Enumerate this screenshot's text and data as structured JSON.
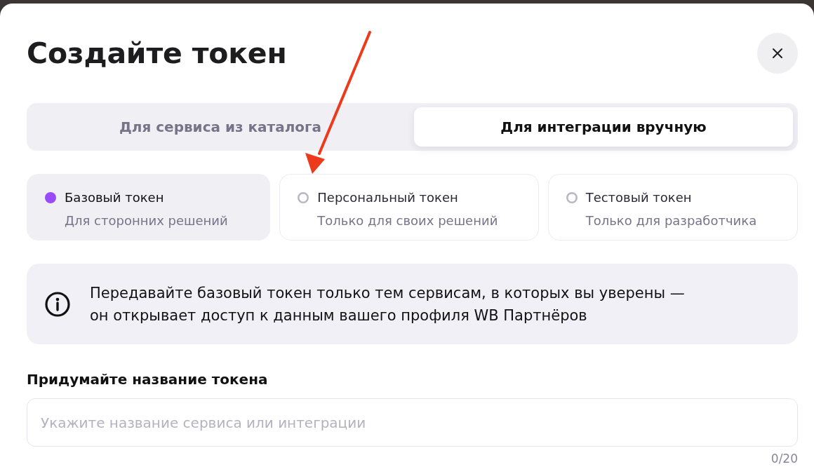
{
  "dialog": {
    "title": "Создайте токен"
  },
  "tabs": [
    {
      "label": "Для сервиса из каталога",
      "selected": false
    },
    {
      "label": "Для интеграции вручную",
      "selected": true
    }
  ],
  "token_types": [
    {
      "title": "Базовый токен",
      "subtitle": "Для сторонних решений",
      "selected": true
    },
    {
      "title": "Персональный токен",
      "subtitle": "Только для своих решений",
      "selected": false
    },
    {
      "title": "Тестовый токен",
      "subtitle": "Только для разработчика",
      "selected": false
    }
  ],
  "notice": {
    "text": "Передавайте базовый токен только тем сервисам, в которых вы уверены — он открывает доступ к данным вашего профиля WB Партнёров"
  },
  "name_field": {
    "label": "Придумайте название токена",
    "placeholder": "Укажите название сервиса или интеграции",
    "counter": "0/20"
  }
}
